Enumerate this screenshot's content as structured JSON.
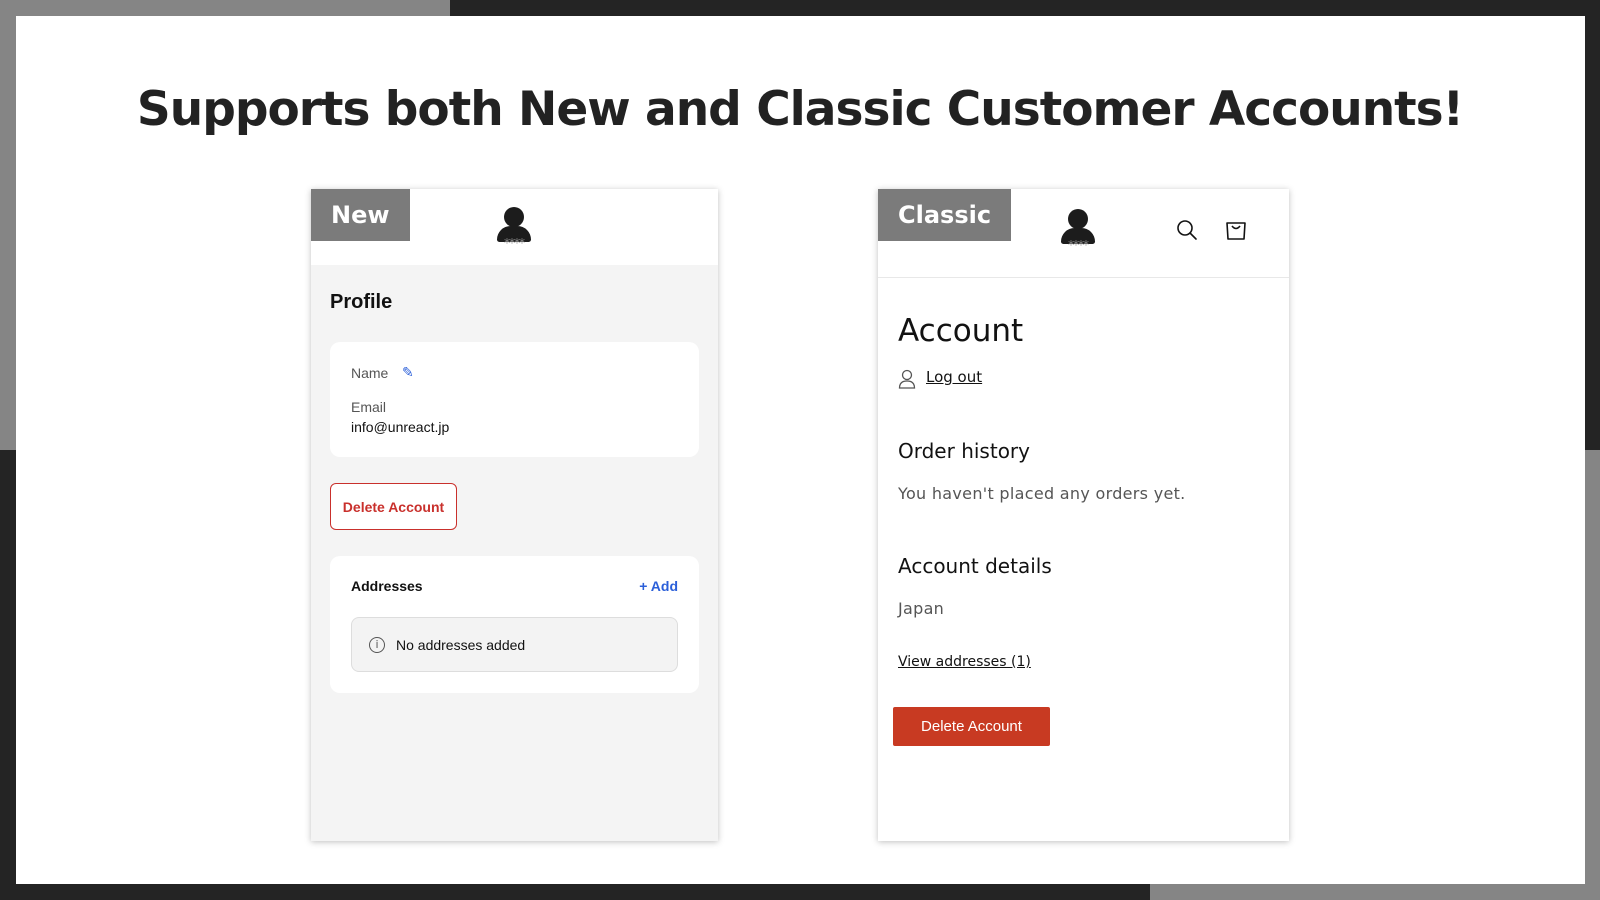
{
  "headline": "Supports both New and Classic Customer Accounts!",
  "new_panel": {
    "tag": "New",
    "logo_stars": "****",
    "profile_title": "Profile",
    "name_label": "Name",
    "email_label": "Email",
    "email_value": "info@unreact.jp",
    "delete_button": "Delete Account",
    "addresses_title": "Addresses",
    "add_link": "+ Add",
    "no_addresses": "No addresses added"
  },
  "classic_panel": {
    "tag": "Classic",
    "logo_stars": "****",
    "title": "Account",
    "logout": "Log out",
    "order_history_title": "Order history",
    "order_history_text": "You haven't placed any orders yet.",
    "account_details_title": "Account details",
    "account_details_text": "Japan",
    "view_addresses": "View addresses (1)",
    "delete_button": "Delete Account"
  },
  "colors": {
    "accent_blue": "#2b5fd9",
    "danger_red": "#c9302c",
    "classic_red": "#c83a22",
    "tag_gray": "#7b7b7b"
  }
}
